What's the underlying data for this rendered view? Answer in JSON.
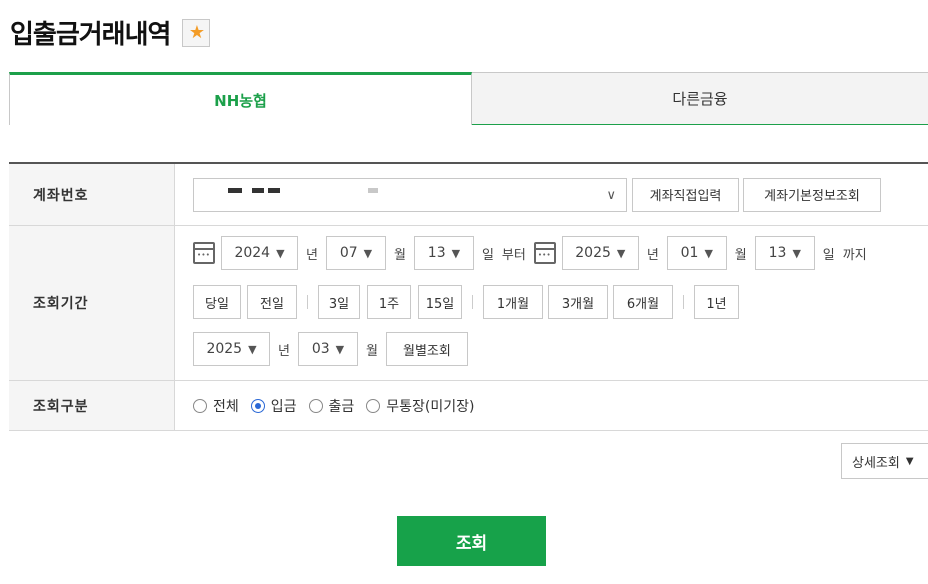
{
  "page": {
    "title": "입출금거래내역",
    "favorite_icon": "star-icon",
    "accent": "#1ca04a"
  },
  "tabs": [
    {
      "label": "NH농협",
      "active": true
    },
    {
      "label": "다른금융",
      "active": false
    }
  ],
  "account": {
    "label": "계좌번호",
    "direct_input_label": "계좌직접입력",
    "info_label": "계좌기본정보조회"
  },
  "period": {
    "label": "조회기간",
    "from": {
      "year": "2024",
      "month": "07",
      "day": "13"
    },
    "to": {
      "year": "2025",
      "month": "01",
      "day": "13"
    },
    "unit_year": "년",
    "unit_month": "월",
    "unit_day": "일",
    "from_suffix": "부터",
    "to_suffix": "까지",
    "quick": {
      "today": "당일",
      "prev_day": "전일",
      "d3": "3일",
      "w1": "1주",
      "d15": "15일",
      "m1": "1개월",
      "m3": "3개월",
      "m6": "6개월",
      "y1": "1년"
    },
    "monthly": {
      "year": "2025",
      "month": "03",
      "button": "월별조회"
    }
  },
  "type": {
    "label": "조회구분",
    "options": [
      {
        "label": "전체",
        "selected": false
      },
      {
        "label": "입금",
        "selected": true
      },
      {
        "label": "출금",
        "selected": false
      },
      {
        "label": "무통장(미기장)",
        "selected": false
      }
    ]
  },
  "detail_label": "상세조회",
  "submit_label": "조회"
}
